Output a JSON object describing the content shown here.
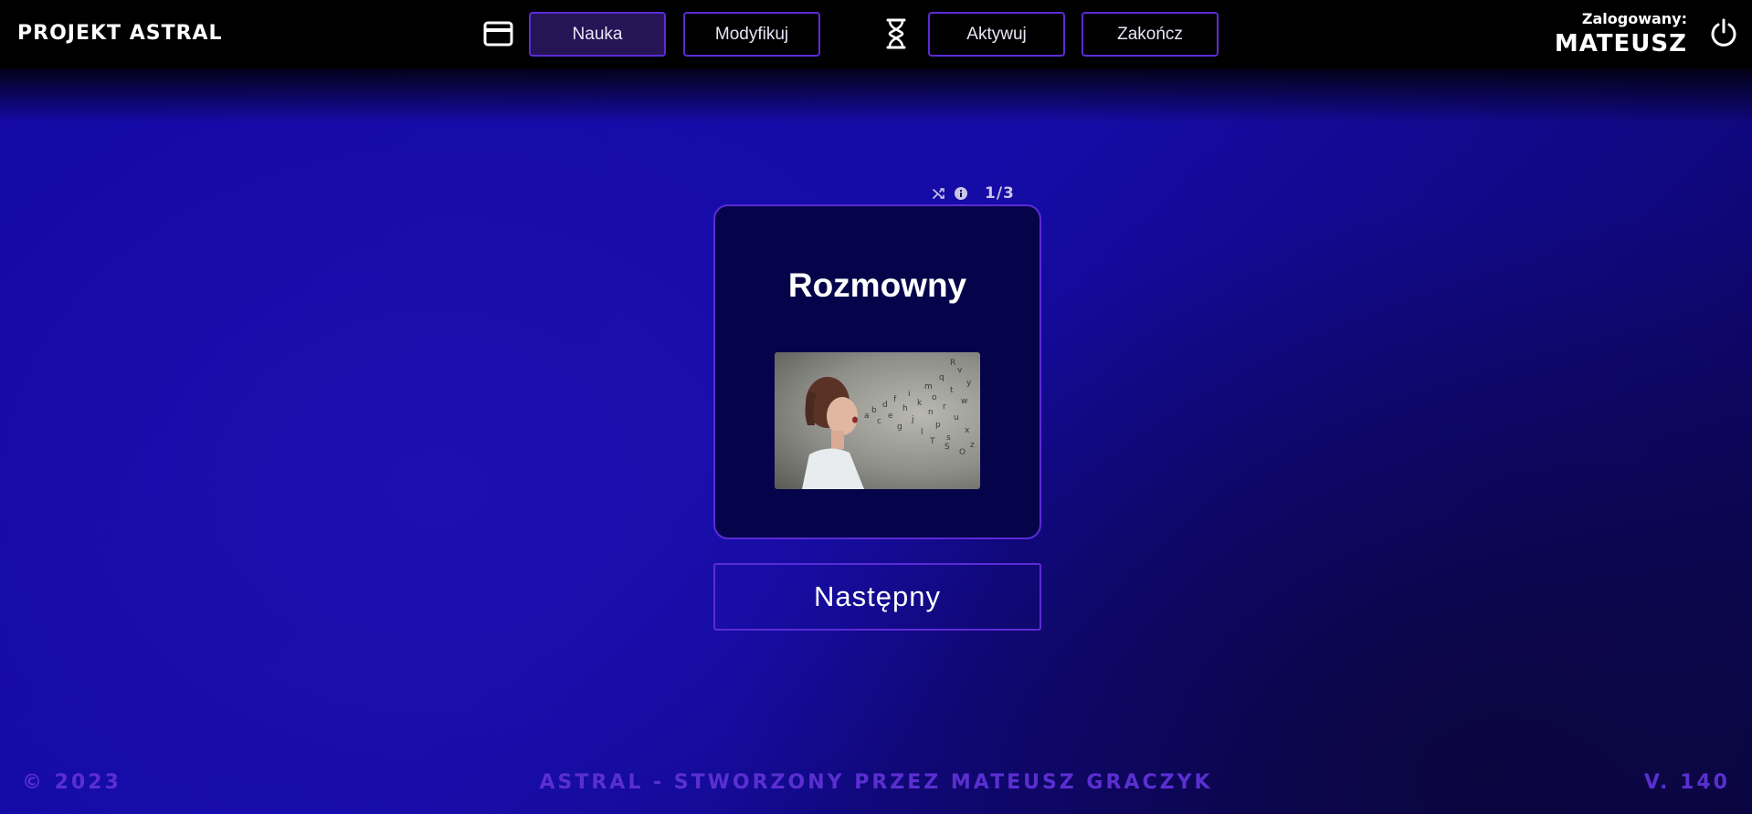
{
  "header": {
    "logo": "PROJEKT ASTRAL",
    "nav": [
      {
        "label": "Nauka",
        "active": true
      },
      {
        "label": "Modyfikuj",
        "active": false
      },
      {
        "label": "Aktywuj",
        "active": false
      },
      {
        "label": "Zakończ",
        "active": false
      }
    ],
    "user_label": "Zalogowany:",
    "user_name": "MATEUSZ"
  },
  "card": {
    "counter": "1/3",
    "word": "Rozmowny",
    "image_icon": "woman-speaking-letters-image"
  },
  "actions": {
    "next_label": "Następny"
  },
  "footer": {
    "copyright": "© 2023",
    "credit": "ASTRAL - STWORZONY PRZEZ MATEUSZ GRACZYK",
    "version": "V. 140"
  },
  "colors": {
    "accent": "#5b2bd6",
    "background": "#150ca8",
    "card_bg": "#05044a",
    "footer_text": "#5a2fd1"
  }
}
